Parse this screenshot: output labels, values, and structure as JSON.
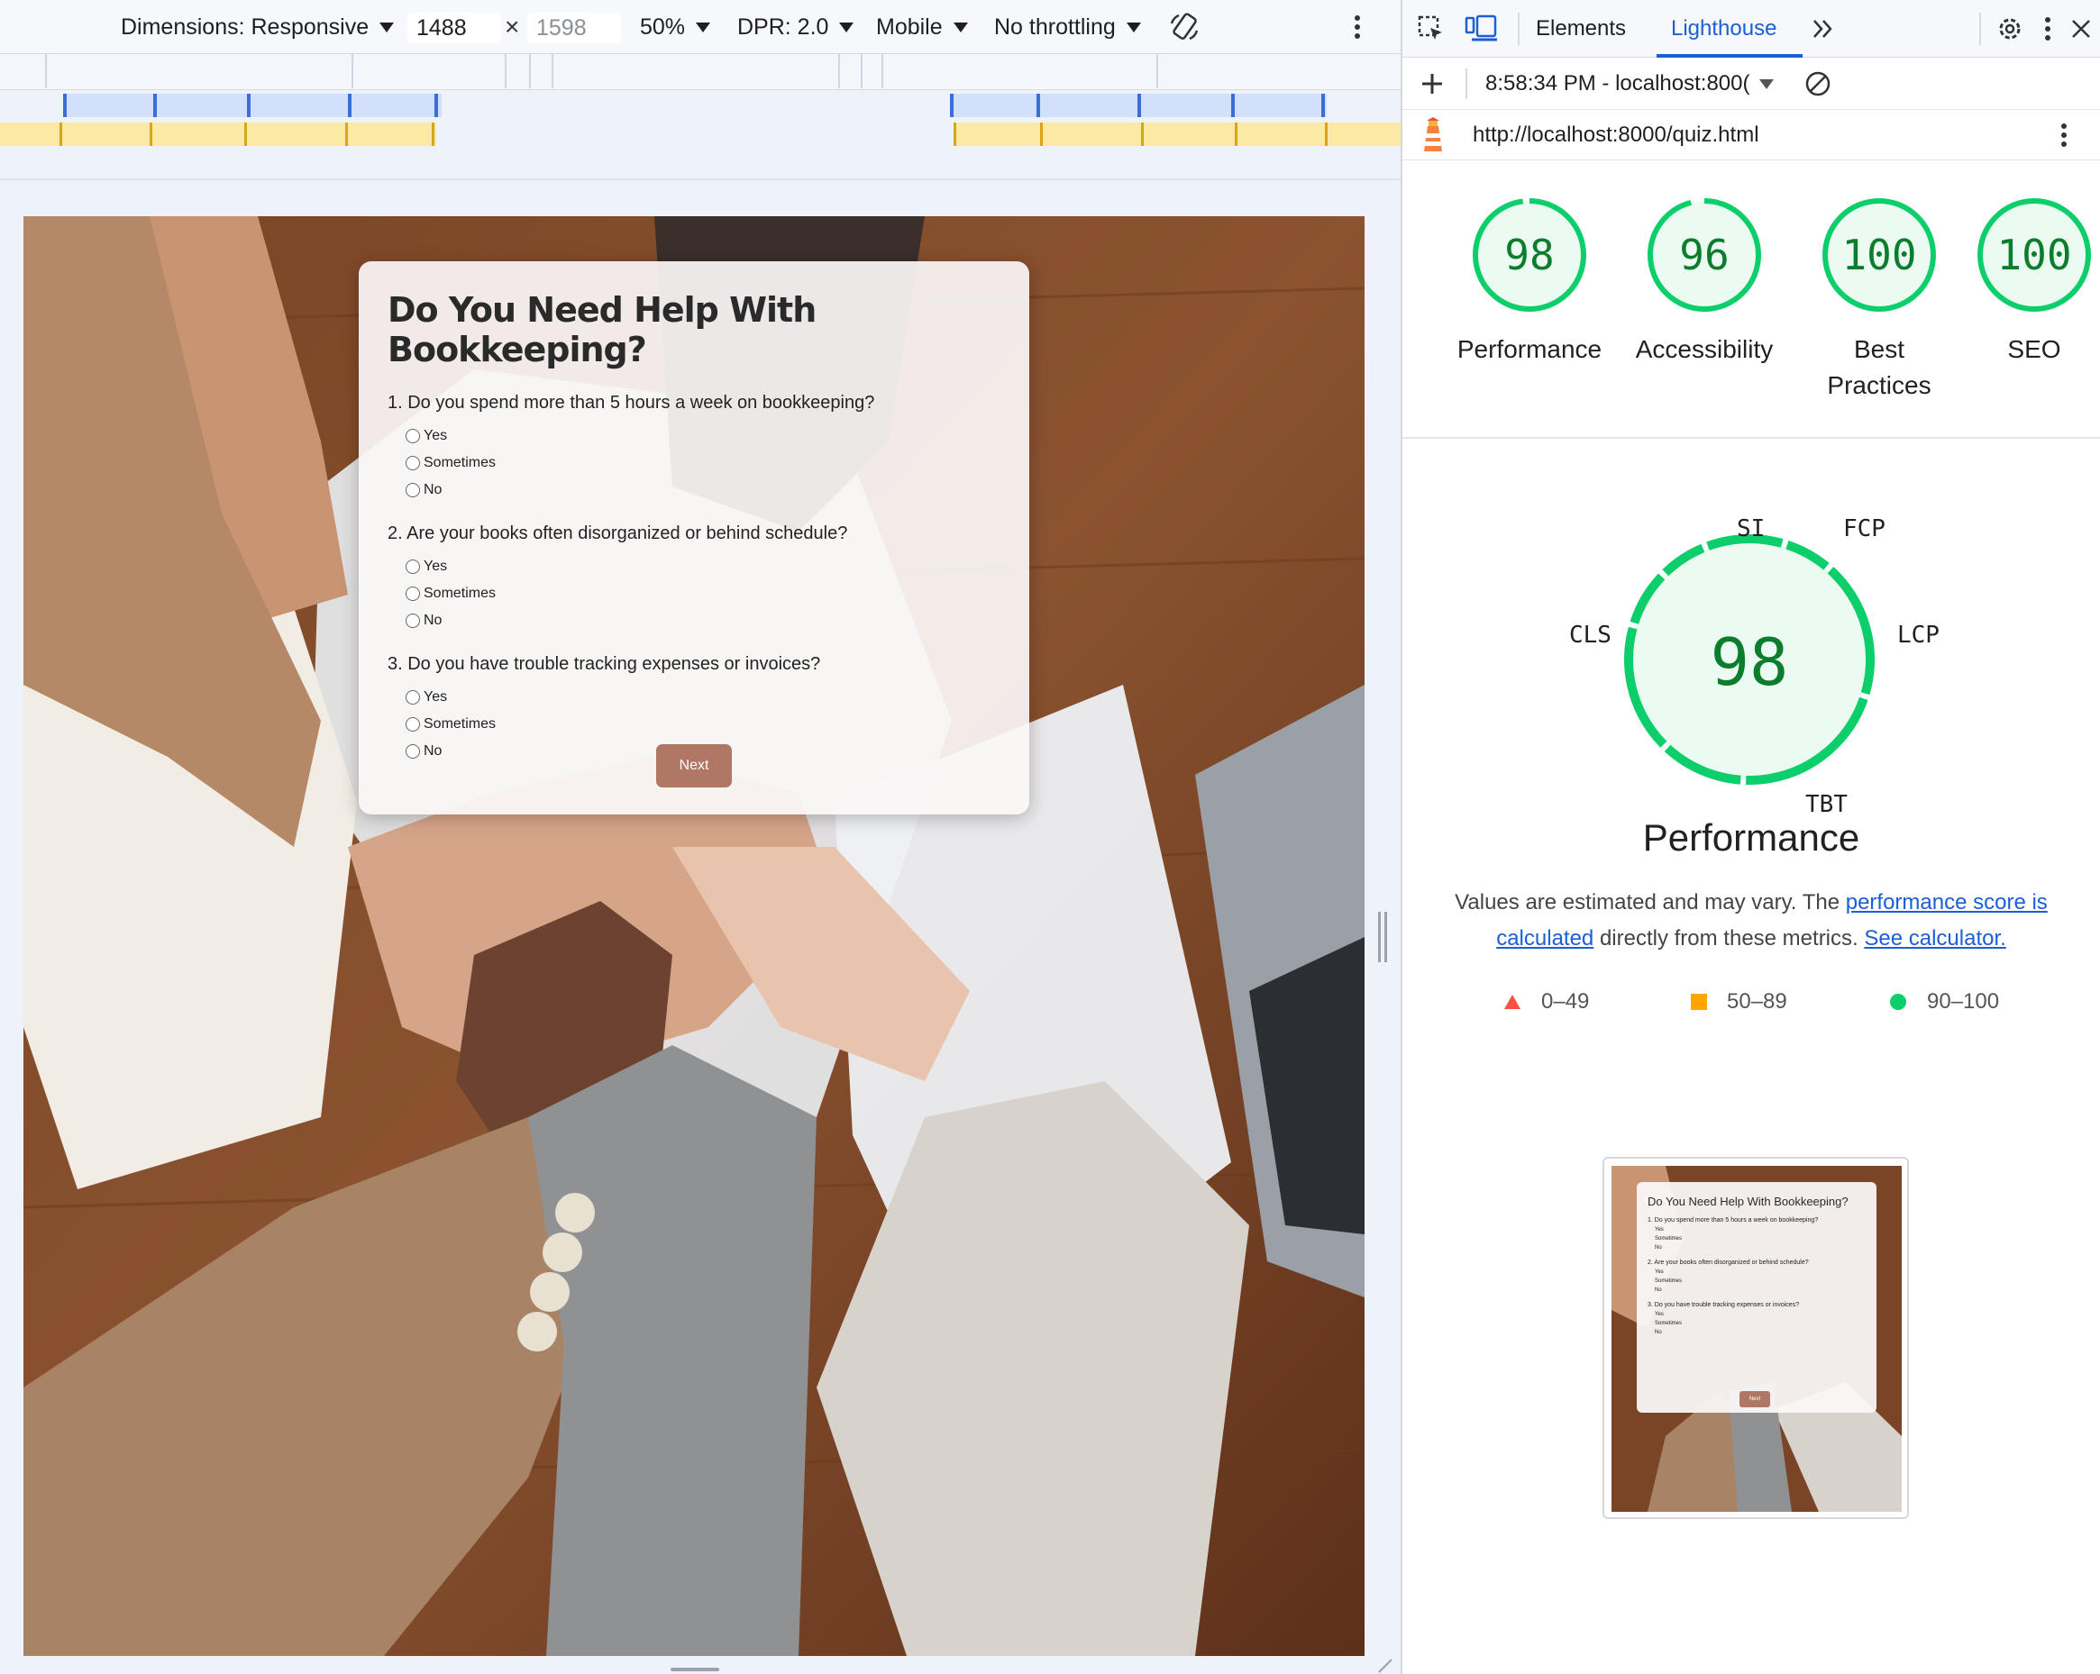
{
  "device_toolbar": {
    "dimensions_label": "Dimensions: Responsive",
    "width_value": "1488",
    "times_symbol": "×",
    "height_value": "1598",
    "zoom_label": "50%",
    "dpr_label": "DPR: 2.0",
    "device_mode_label": "Mobile",
    "throttling_label": "No throttling"
  },
  "quiz": {
    "title": "Do You Need Help With Bookkeeping?",
    "questions": [
      {
        "text": "1. Do you spend more than 5 hours a week on bookkeeping?",
        "options": [
          "Yes",
          "Sometimes",
          "No"
        ]
      },
      {
        "text": "2. Are your books often disorganized or behind schedule?",
        "options": [
          "Yes",
          "Sometimes",
          "No"
        ]
      },
      {
        "text": "3. Do you have trouble tracking expenses or invoices?",
        "options": [
          "Yes",
          "Sometimes",
          "No"
        ]
      }
    ],
    "next_label": "Next"
  },
  "devtools": {
    "tabs": {
      "elements": "Elements",
      "lighthouse": "Lighthouse"
    },
    "report_selector": "8:58:34 PM - localhost:800(",
    "url": "http://localhost:8000/quiz.html",
    "scores": [
      {
        "value": "98",
        "label": "Performance"
      },
      {
        "value": "96",
        "label": "Accessibility"
      },
      {
        "value": "100",
        "label": "Best Practices"
      },
      {
        "value": "100",
        "label": "SEO"
      }
    ],
    "performance": {
      "score": "98",
      "title": "Performance",
      "metrics": {
        "si": "SI",
        "fcp": "FCP",
        "cls": "CLS",
        "lcp": "LCP",
        "tbt": "TBT"
      },
      "note_prefix": "Values are estimated and may vary. The ",
      "note_link1": "performance score is calculated",
      "note_middle": " directly from these metrics. ",
      "note_link2": "See calculator."
    },
    "legend": {
      "fail": "0–49",
      "average": "50–89",
      "pass": "90–100"
    },
    "colors": {
      "pass": "#0cce6b",
      "pass_text": "#0b7d2c",
      "average": "#ffa400",
      "fail": "#ff4e42",
      "accent": "#1a5fd6"
    }
  }
}
